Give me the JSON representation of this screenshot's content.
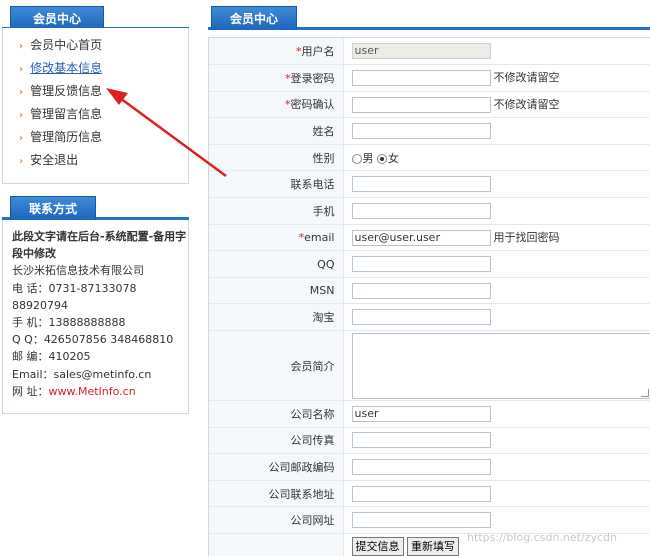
{
  "member_center": {
    "tab_label": "会员中心",
    "menu": [
      {
        "label": "会员中心首页"
      },
      {
        "label": "修改基本信息"
      },
      {
        "label": "管理反馈信息"
      },
      {
        "label": "管理留言信息"
      },
      {
        "label": "管理简历信息"
      },
      {
        "label": "安全退出"
      }
    ],
    "active_index": 1
  },
  "contact": {
    "tab_label": "联系方式",
    "note": "此段文字请在后台-系统配置-备用字段中修改",
    "company": "长沙米拓信息技术有限公司",
    "phone": "电  话：0731-87133078",
    "phone2": "88920794",
    "mobile": "手  机：13888888888",
    "qq": "Q    Q：426507856 348468810",
    "zip": "邮  编：410205",
    "email": "Email：sales@metinfo.cn",
    "website_label": "网  址：",
    "website": "www.MetInfo.cn"
  },
  "form": {
    "tab_label": "会员中心",
    "username": {
      "label": "用户名",
      "value": "user"
    },
    "password": {
      "label": "登录密码",
      "hint": "不修改请留空"
    },
    "password_confirm": {
      "label": "密码确认",
      "hint": "不修改请留空"
    },
    "name": {
      "label": "姓名"
    },
    "gender": {
      "label": "性别",
      "male": "男",
      "female": "女",
      "selected": "女"
    },
    "telephone": {
      "label": "联系电话"
    },
    "mobile": {
      "label": "手机"
    },
    "email": {
      "label": "email",
      "value": "user@user.user",
      "hint": "用于找回密码"
    },
    "qq": {
      "label": "QQ"
    },
    "msn": {
      "label": "MSN"
    },
    "taobao": {
      "label": "淘宝"
    },
    "intro": {
      "label": "会员简介"
    },
    "company_name": {
      "label": "公司名称",
      "value": "user"
    },
    "company_fax": {
      "label": "公司传真"
    },
    "company_zip": {
      "label": "公司邮政编码"
    },
    "company_address": {
      "label": "公司联系地址"
    },
    "company_website": {
      "label": "公司网址"
    },
    "submit_label": "提交信息",
    "reset_label": "重新填写"
  },
  "required_mark": "*",
  "watermark": "https://blog.csdn.net/zycdn",
  "colors": {
    "tab_blue": "#1d74c9",
    "arrow_red": "#e02020",
    "link_blue": "#2b5fad"
  }
}
